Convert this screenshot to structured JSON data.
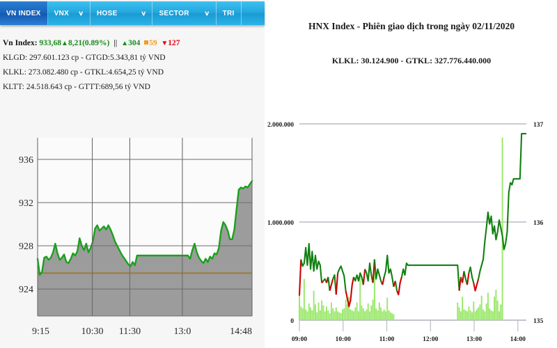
{
  "nav": {
    "items": [
      {
        "label": "VN INDEX",
        "active": true,
        "caret": false
      },
      {
        "label": "VNX",
        "active": false,
        "caret": true
      },
      {
        "label": "HOSE",
        "active": false,
        "caret": true
      },
      {
        "label": "SECTOR",
        "active": false,
        "caret": true
      },
      {
        "label": "TRI",
        "active": false,
        "caret": false
      }
    ],
    "caret_glyph": "∨"
  },
  "info": {
    "index_name": "Vn Index:",
    "index_value": "933,68",
    "index_change": "8,21(0.89%)",
    "up_triangle": "▲",
    "down_triangle": "▼",
    "separator": "||",
    "advancers": "304",
    "unchanged": "59",
    "decliners": "127",
    "line_klgd": "KLGD: 297.601.123 cp - GTGD:5.343,81 tỷ VND",
    "line_klkl": "KLKL: 273.082.480 cp - GTKL:4.654,25 tỷ VND",
    "line_kltt": "KLTT: 24.518.643 cp - GTTT:689,56 tỷ VND"
  },
  "hnx": {
    "title": "HNX Index - Phiên giao dịch trong ngày 02/11/2020",
    "subtitle": "KLKL: 30.124.900 - GTKL: 327.776.440.000"
  },
  "colors": {
    "nav_active": "#1862b8",
    "nav_base": "#23a6dd",
    "up_green": "#158d16",
    "ref_orange": "#f0a020",
    "down_red": "#e8000b",
    "vn_line_green": "#19a11c",
    "vn_fill_gray": "#9c9c9c",
    "vn_ref_line": "#9a7d3c",
    "hnx_line_green": "#118011",
    "hnx_line_red": "#d00000",
    "hnx_volume_green": "#9ae86a",
    "hnx_grid": "#b9bcc4"
  },
  "chart_data": [
    {
      "type": "area",
      "name": "vn-index-intraday",
      "title": "",
      "xlabel": "",
      "ylabel": "",
      "ylim": [
        921.5,
        938.0
      ],
      "yticks": [
        936,
        932,
        928,
        924
      ],
      "xticks": [
        "9:15",
        "10:30",
        "11:30",
        "13:0",
        "14:48"
      ],
      "reference_value": 925.47,
      "grid": true,
      "series": [
        {
          "name": "VN Index",
          "color": "#19a11c",
          "values": [
            926.8,
            925.3,
            925.6,
            926.9,
            927.0,
            926.7,
            926.9,
            927.4,
            928.2,
            927.3,
            926.7,
            926.9,
            927.2,
            926.5,
            926.4,
            926.8,
            927.3,
            927.1,
            927.5,
            928.7,
            928.0,
            927.6,
            928.2,
            927.4,
            927.8,
            928.4,
            929.6,
            929.9,
            929.4,
            929.6,
            929.8,
            929.5,
            929.9,
            929.5,
            929.0,
            928.4,
            928.0,
            927.6,
            927.2,
            926.9,
            926.6,
            926.3,
            926.1,
            926.5,
            926.2,
            927.1,
            927.1,
            927.1,
            927.1,
            927.1,
            927.1,
            927.1,
            927.1,
            927.1,
            927.1,
            927.1,
            927.1,
            927.1,
            927.1,
            927.1,
            927.1,
            927.1,
            927.1,
            927.1,
            927.1,
            927.1,
            927.1,
            927.1,
            927.1,
            926.8,
            927.6,
            928.2,
            927.4,
            926.9,
            926.6,
            926.4,
            926.8,
            926.5,
            927.0,
            926.8,
            927.3,
            927.2,
            927.8,
            929.4,
            930.2,
            929.9,
            929.4,
            928.6,
            928.6,
            929.5,
            931.4,
            933.2,
            933.4,
            933.3,
            933.5,
            933.4,
            933.7,
            934.0
          ]
        }
      ]
    },
    {
      "type": "line",
      "name": "hnx-index-intraday",
      "title": "HNX Index - Phiên giao dịch trong ngày 02/11/2020",
      "subtitle": "KLKL: 30.124.900 - GTKL: 327.776.440.000",
      "xlabel": "",
      "ylabel_left": "",
      "ylabel_right": "",
      "yticks_left": [
        "2.000.000",
        "1.000.000",
        "0"
      ],
      "yticks_left_values": [
        2000000,
        1000000,
        0
      ],
      "yticks_right": [
        "137",
        "136",
        "135"
      ],
      "yticks_right_values": [
        137,
        136,
        135
      ],
      "xticks": [
        "09:00",
        "10:00",
        "11:00",
        "12:00",
        "13:00",
        "14:00"
      ],
      "ylim_right": [
        135,
        137
      ],
      "ylim_left": [
        0,
        2000000
      ],
      "grid": true,
      "series": [
        {
          "name": "HNX Index",
          "color": "#118011",
          "negative_color": "#d00000",
          "values": [
            135.25,
            135.62,
            135.55,
            135.58,
            135.74,
            135.56,
            135.78,
            135.52,
            135.7,
            135.5,
            135.66,
            135.52,
            135.6,
            135.56,
            135.38,
            135.4,
            135.42,
            135.38,
            135.44,
            135.3,
            135.36,
            135.42,
            135.46,
            135.26,
            135.48,
            135.52,
            135.55,
            135.5,
            135.45,
            135.3,
            135.22,
            135.14,
            135.2,
            135.36,
            135.44,
            135.4,
            135.46,
            135.4,
            135.48,
            135.44,
            135.36,
            135.52,
            135.48,
            135.4,
            135.58,
            135.46,
            135.38,
            135.62,
            135.42,
            135.52,
            135.46,
            135.4,
            135.36,
            135.44,
            135.5,
            135.66,
            135.48,
            135.52,
            135.44,
            135.34,
            135.4,
            135.3,
            135.26,
            135.38,
            135.44,
            135.52,
            135.46,
            135.58,
            135.56,
            135.56,
            135.56,
            135.56,
            135.56,
            135.56,
            135.56,
            135.56,
            135.56,
            135.56,
            135.56,
            135.56,
            135.56,
            135.56,
            135.56,
            135.56,
            135.56,
            135.56,
            135.56,
            135.56,
            135.56,
            135.56,
            135.56,
            135.56,
            135.56,
            135.56,
            135.56,
            135.56,
            135.56,
            135.56,
            135.56,
            135.56,
            135.3,
            135.44,
            135.38,
            135.5,
            135.42,
            135.36,
            135.48,
            135.54,
            135.44,
            135.38,
            135.3,
            135.36,
            135.42,
            135.5,
            135.56,
            135.62,
            135.8,
            135.94,
            136.1,
            135.98,
            136.06,
            135.88,
            135.96,
            135.82,
            135.9,
            136.02,
            135.94,
            135.86,
            135.72,
            135.78,
            135.9,
            136.3,
            136.4,
            136.38,
            136.44,
            136.44,
            136.44,
            136.44,
            136.44,
            136.9,
            136.9,
            136.9,
            136.9
          ]
        },
        {
          "name": "Volume",
          "color": "#9ae86a",
          "type": "bar",
          "values": [
            260000,
            140000,
            120000,
            420000,
            110000,
            90000,
            170000,
            130000,
            100000,
            300000,
            160000,
            80000,
            180000,
            100000,
            200000,
            150000,
            90000,
            140000,
            100000,
            70000,
            180000,
            120000,
            90000,
            130000,
            90000,
            80000,
            70000,
            110000,
            120000,
            210000,
            160000,
            240000,
            110000,
            100000,
            90000,
            130000,
            180000,
            90000,
            460000,
            150000,
            120000,
            90000,
            110000,
            170000,
            90000,
            150000,
            210000,
            520000,
            120000,
            100000,
            180000,
            130000,
            90000,
            110000,
            90000,
            230000,
            100000,
            80000,
            70000,
            60000,
            0,
            0,
            0,
            0,
            0,
            0,
            0,
            0,
            0,
            0,
            0,
            0,
            0,
            0,
            0,
            0,
            0,
            0,
            0,
            0,
            0,
            0,
            0,
            0,
            0,
            0,
            0,
            0,
            0,
            0,
            0,
            0,
            0,
            0,
            0,
            0,
            0,
            0,
            0,
            180000,
            130000,
            90000,
            240000,
            110000,
            100000,
            90000,
            140000,
            100000,
            80000,
            190000,
            90000,
            110000,
            130000,
            160000,
            250000,
            110000,
            90000,
            170000,
            280000,
            120000,
            100000,
            90000,
            240000,
            310000,
            200000,
            90000,
            160000,
            1860000,
            0,
            0,
            0,
            0,
            0,
            0
          ]
        }
      ]
    }
  ]
}
